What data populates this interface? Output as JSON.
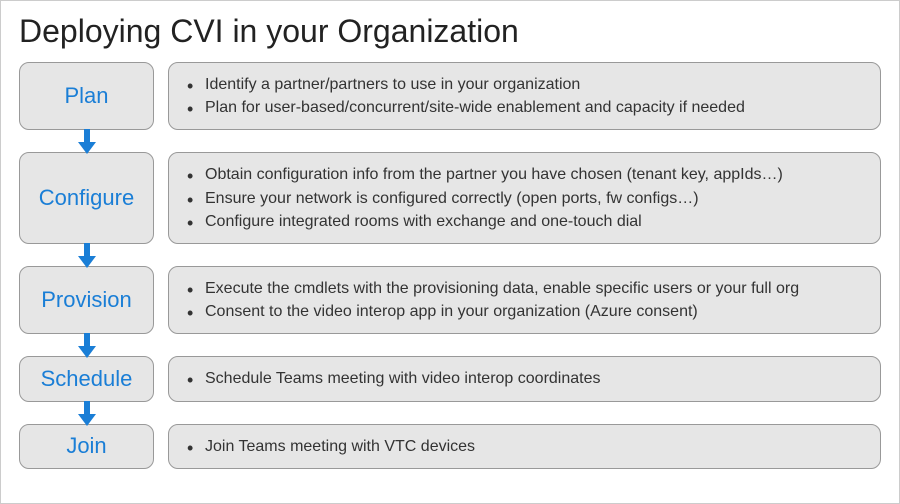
{
  "title": "Deploying CVI in your Organization",
  "steps": [
    {
      "label": "Plan",
      "items": [
        "Identify a partner/partners to use in your organization",
        "Plan for user-based/concurrent/site-wide enablement and capacity if needed"
      ]
    },
    {
      "label": "Configure",
      "items": [
        "Obtain configuration info from the partner you have chosen (tenant key, appIds…)",
        "Ensure your network is configured correctly (open ports, fw configs…)",
        "Configure integrated rooms with exchange and one-touch dial"
      ]
    },
    {
      "label": "Provision",
      "items": [
        "Execute the cmdlets with the provisioning data, enable specific users or your full org",
        "Consent to the video interop app in your organization (Azure consent)"
      ]
    },
    {
      "label": "Schedule",
      "items": [
        "Schedule Teams meeting with video interop coordinates"
      ]
    },
    {
      "label": "Join",
      "items": [
        "Join Teams meeting with VTC devices"
      ]
    }
  ]
}
